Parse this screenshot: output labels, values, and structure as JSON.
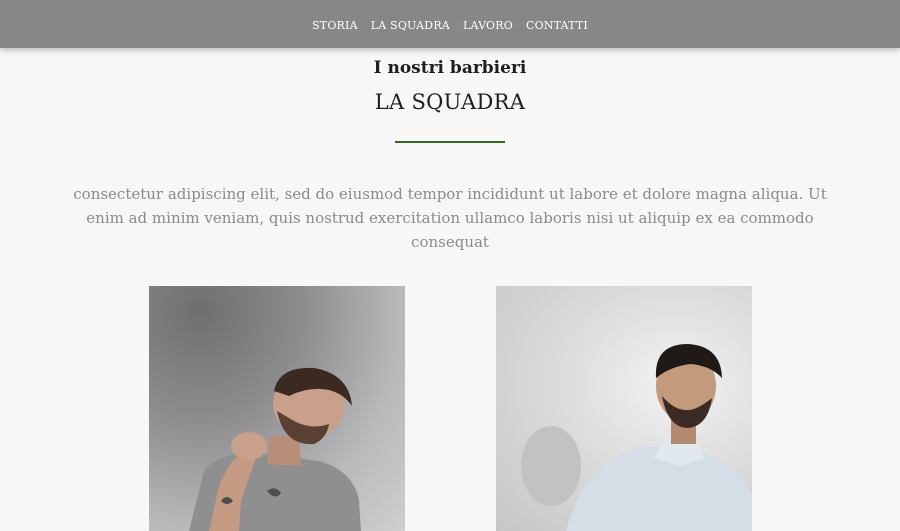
{
  "nav": {
    "items": [
      "STORIA",
      "LA SQUADRA",
      "LAVORO",
      "CONTATTI"
    ]
  },
  "section": {
    "subtitle": "I nostri barbieri",
    "title": "LA SQUADRA",
    "intro": "consectetur adipiscing elit, sed do eiusmod tempor incididunt ut labore et dolore magna aliqua. Ut enim ad minim veniam, quis nostrud exercitation ullamco laboris nisi ut aliquip ex ea commodo consequat",
    "accent_color": "#2e6b1f"
  },
  "team": [
    {
      "photo": "barber-photo-laughing-man"
    },
    {
      "photo": "barber-photo-man-in-shirt"
    }
  ]
}
